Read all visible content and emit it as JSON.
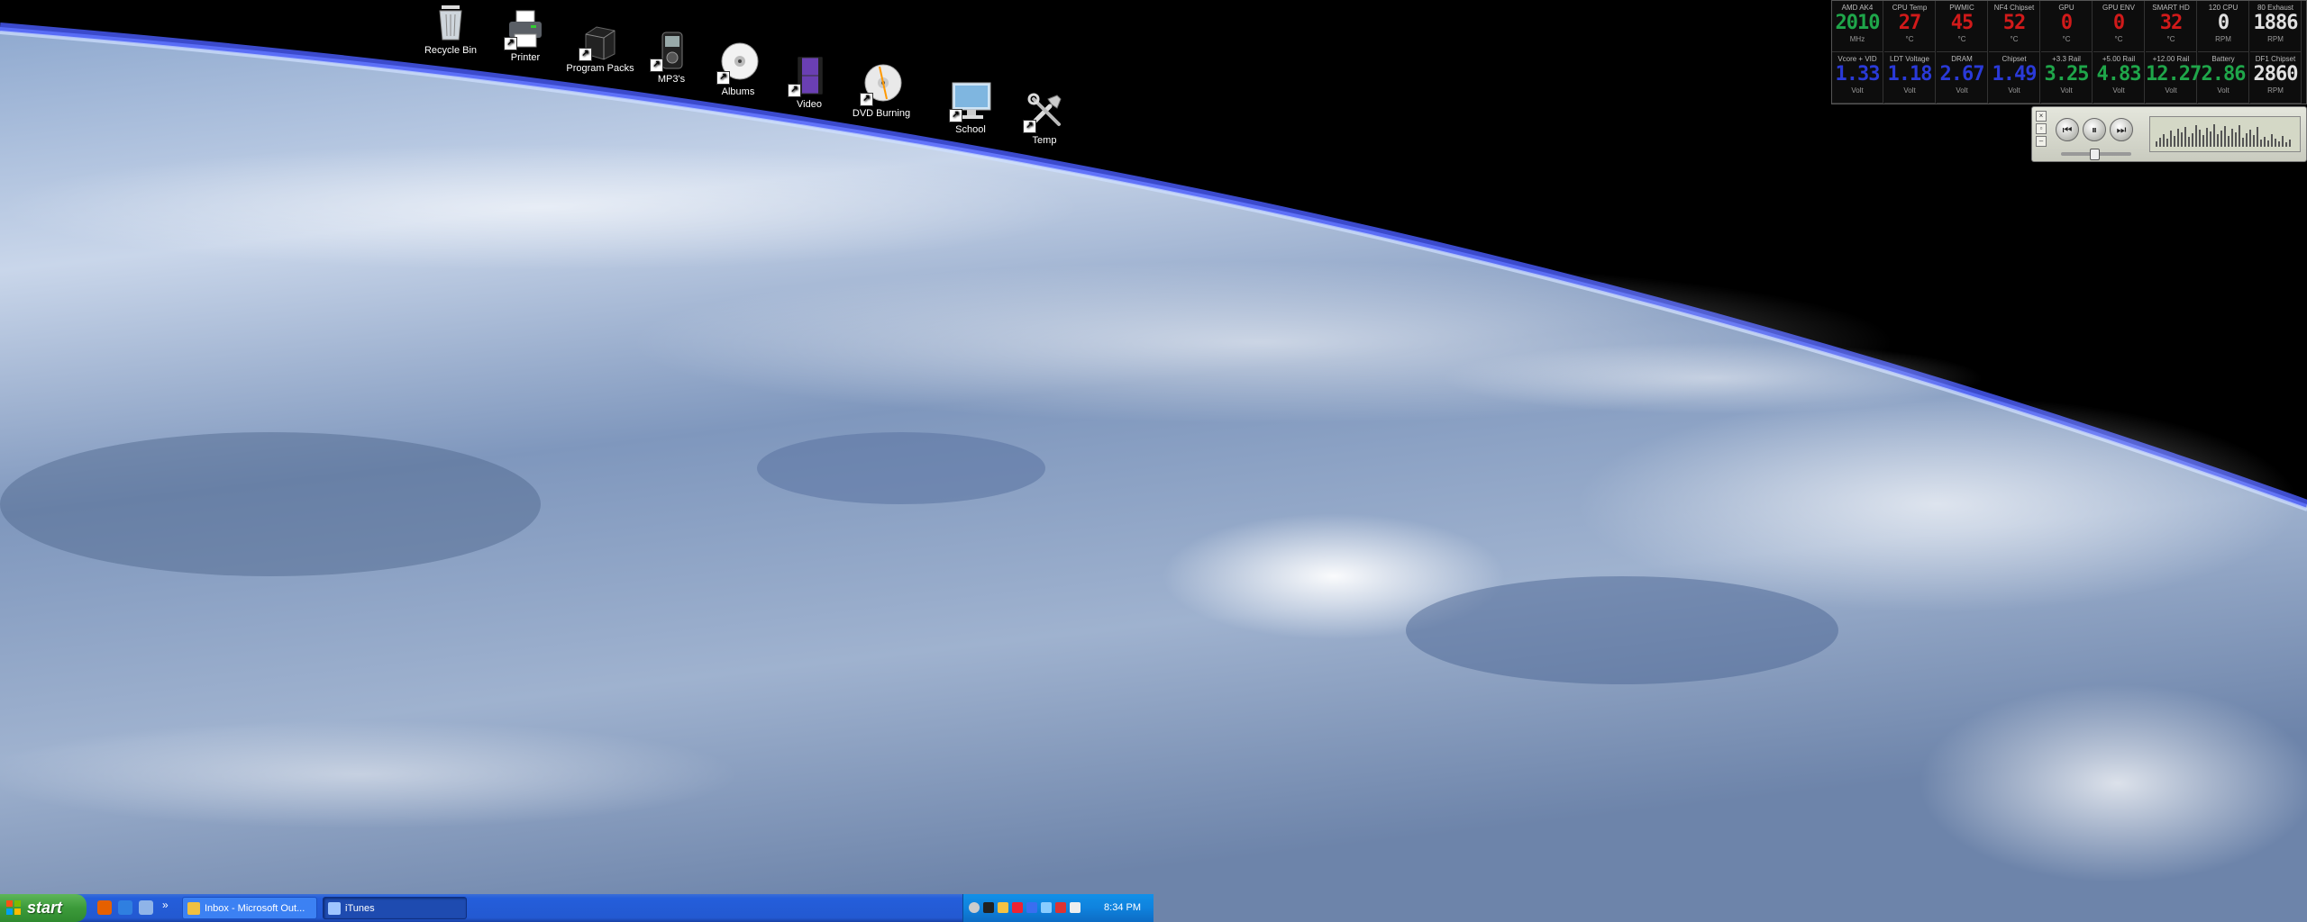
{
  "desktop": {
    "icons": [
      {
        "label": "Recycle Bin",
        "icon": "recycle-bin-icon"
      },
      {
        "label": "Printer",
        "icon": "printer-icon"
      },
      {
        "label": "Program Packs",
        "icon": "program-packs-icon"
      },
      {
        "label": "MP3's",
        "icon": "mp3-player-icon"
      },
      {
        "label": "Albums",
        "icon": "cd-disc-icon"
      },
      {
        "label": "Video",
        "icon": "video-film-icon"
      },
      {
        "label": "DVD Burning",
        "icon": "dvd-disc-icon"
      },
      {
        "label": "School",
        "icon": "monitor-icon"
      },
      {
        "label": "Temp",
        "icon": "tools-icon"
      }
    ]
  },
  "monitor": {
    "row1": [
      {
        "title": "AMD AK4",
        "value": "2010",
        "unit": "MHz",
        "color": "#1fa64a"
      },
      {
        "title": "CPU Temp",
        "value": "27",
        "unit": "°C",
        "color": "#d11a1a"
      },
      {
        "title": "PWMIC",
        "value": "45",
        "unit": "°C",
        "color": "#d11a1a"
      },
      {
        "title": "NF4 Chipset",
        "value": "52",
        "unit": "°C",
        "color": "#d11a1a"
      },
      {
        "title": "GPU",
        "value": "0",
        "unit": "°C",
        "color": "#d11a1a"
      },
      {
        "title": "GPU ENV",
        "value": "0",
        "unit": "°C",
        "color": "#d11a1a"
      },
      {
        "title": "SMART HD",
        "value": "32",
        "unit": "°C",
        "color": "#d11a1a"
      },
      {
        "title": "120 CPU",
        "value": "0",
        "unit": "RPM",
        "color": "#e0e0e0"
      },
      {
        "title": "80 Exhaust",
        "value": "1886",
        "unit": "RPM",
        "color": "#e0e0e0"
      }
    ],
    "row2": [
      {
        "title": "Vcore + VID",
        "value": "1.33",
        "unit": "Volt",
        "color": "#2a3ad8"
      },
      {
        "title": "LDT Voltage",
        "value": "1.18",
        "unit": "Volt",
        "color": "#2a3ad8"
      },
      {
        "title": "DRAM",
        "value": "2.67",
        "unit": "Volt",
        "color": "#2a3ad8"
      },
      {
        "title": "Chipset",
        "value": "1.49",
        "unit": "Volt",
        "color": "#2a3ad8"
      },
      {
        "title": "+3.3 Rail",
        "value": "3.25",
        "unit": "Volt",
        "color": "#1fa64a"
      },
      {
        "title": "+5.00 Rail",
        "value": "4.83",
        "unit": "Volt",
        "color": "#1fa64a"
      },
      {
        "title": "+12.00 Rail",
        "value": "12.27",
        "unit": "Volt",
        "color": "#1fa64a"
      },
      {
        "title": "Battery",
        "value": "2.86",
        "unit": "Volt",
        "color": "#1fa64a"
      },
      {
        "title": "DF1 Chipset",
        "value": "2860",
        "unit": "RPM",
        "color": "#e0e0e0"
      }
    ]
  },
  "player": {
    "prev": "⏮",
    "pause": "⏸",
    "next": "⏭",
    "volume": 0.45,
    "viz": [
      6,
      10,
      14,
      9,
      18,
      12,
      20,
      16,
      22,
      11,
      15,
      24,
      19,
      13,
      21,
      17,
      25,
      14,
      18,
      23,
      12,
      20,
      16,
      24,
      10,
      15,
      19,
      13,
      22,
      8,
      11,
      7,
      14,
      9,
      6,
      12,
      5,
      8
    ]
  },
  "taskbar": {
    "start": "start",
    "quicklaunch": [
      {
        "icon": "firefox-icon",
        "color": "#e66000"
      },
      {
        "icon": "ie-icon",
        "color": "#2f7fe0"
      },
      {
        "icon": "media-icon",
        "color": "#8fb4e8"
      }
    ],
    "expand": "»",
    "windows": [
      {
        "label": "Inbox - Microsoft Out...",
        "icon": "outlook-icon",
        "active": false
      },
      {
        "label": "iTunes",
        "icon": "itunes-icon",
        "active": true
      }
    ],
    "tray_icons": [
      "speaker-icon",
      "antivirus-icon",
      "clock-sync-icon",
      "calendar-icon",
      "shield-icon",
      "network-icon",
      "flag-icon",
      "java-icon"
    ],
    "clock": "8:34 PM"
  }
}
